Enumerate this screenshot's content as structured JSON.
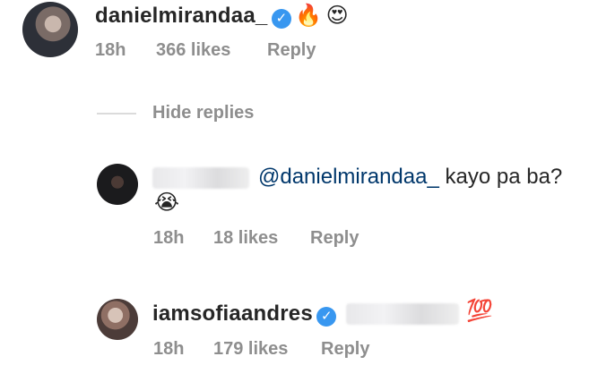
{
  "comment1": {
    "username": "danielmirandaa_",
    "emojis": [
      "🔥",
      "😍"
    ],
    "time": "18h",
    "likes": "366 likes",
    "reply": "Reply"
  },
  "thread": {
    "hide_replies": "Hide replies"
  },
  "reply1": {
    "mention": "@danielmirandaa_",
    "text": "kayo pa ba?",
    "emoji": "😭",
    "time": "18h",
    "likes": "18 likes",
    "reply": "Reply"
  },
  "reply2": {
    "username": "iamsofiaandres",
    "emoji": "💯",
    "time": "18h",
    "likes": "179 likes",
    "reply": "Reply"
  },
  "colors": {
    "verified": "#3897f0",
    "mention": "#00376b",
    "meta": "#8e8e8e",
    "line": "#dbdbdb"
  }
}
